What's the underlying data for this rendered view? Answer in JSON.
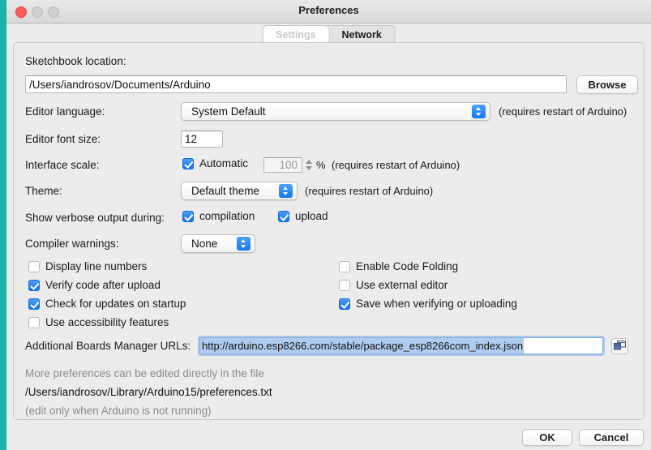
{
  "window": {
    "title": "Preferences",
    "traffic_lights": [
      "close",
      "minimize",
      "maximize"
    ]
  },
  "tabs": [
    {
      "label": "Settings",
      "selected": true
    },
    {
      "label": "Network",
      "selected": false
    }
  ],
  "form": {
    "sketchbook": {
      "label": "Sketchbook location:",
      "value": "/Users/iandrosov/Documents/Arduino",
      "browse_label": "Browse"
    },
    "editor_language": {
      "label": "Editor language:",
      "value": "System Default",
      "note": "(requires restart of Arduino)"
    },
    "editor_font_size": {
      "label": "Editor font size:",
      "value": "12"
    },
    "interface_scale": {
      "label": "Interface scale:",
      "automatic_label": "Automatic",
      "automatic_checked": true,
      "scale_value": "100",
      "percent_label": "%",
      "note": "(requires restart of Arduino)"
    },
    "theme": {
      "label": "Theme:",
      "value": "Default theme",
      "note": "(requires restart of Arduino)"
    },
    "verbose": {
      "label": "Show verbose output during:",
      "compilation_label": "compilation",
      "compilation_checked": true,
      "upload_label": "upload",
      "upload_checked": true
    },
    "compiler_warnings": {
      "label": "Compiler warnings:",
      "value": "None"
    },
    "options_left": [
      {
        "label": "Display line numbers",
        "checked": false
      },
      {
        "label": "Verify code after upload",
        "checked": true
      },
      {
        "label": "Check for updates on startup",
        "checked": true
      },
      {
        "label": "Use accessibility features",
        "checked": false
      }
    ],
    "options_right": [
      {
        "label": "Enable Code Folding",
        "checked": false
      },
      {
        "label": "Use external editor",
        "checked": false
      },
      {
        "label": "Save when verifying or uploading",
        "checked": true
      }
    ],
    "boards_urls": {
      "label": "Additional Boards Manager URLs:",
      "value": "http://arduino.esp8266.com/stable/package_esp8266com_index.json"
    }
  },
  "footer": {
    "line1": "More preferences can be edited directly in the file",
    "line2": "/Users/iandrosov/Library/Arduino15/preferences.txt",
    "line3": "(edit only when Arduino is not running)"
  },
  "actions": {
    "ok_label": "OK",
    "cancel_label": "Cancel"
  },
  "colors": {
    "accent": "#1478ee",
    "selection": "#b0ccef",
    "desktop": "#17b3ad"
  }
}
